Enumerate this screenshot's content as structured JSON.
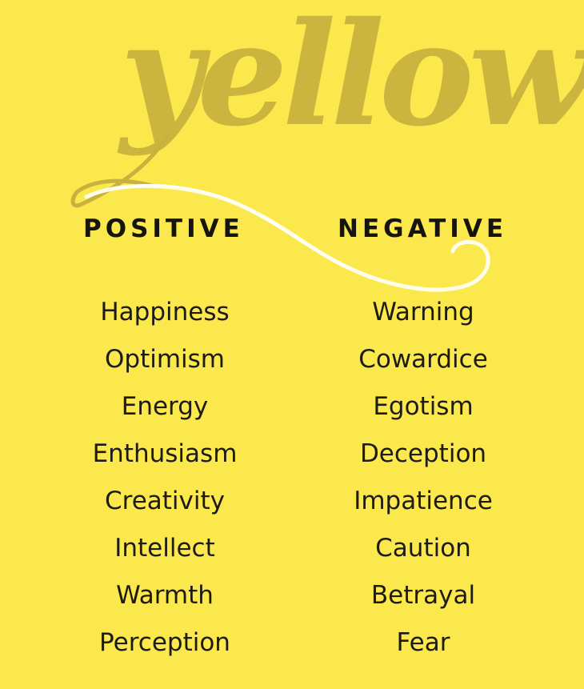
{
  "background_color": "#fbe84d",
  "script_color": "#c9b13e",
  "swirl_color": "#fffef2",
  "title": "yellow",
  "columns": {
    "positive": {
      "header": "POSITIVE",
      "items": [
        "Happiness",
        "Optimism",
        "Energy",
        "Enthusiasm",
        "Creativity",
        "Intellect",
        "Warmth",
        "Perception"
      ]
    },
    "negative": {
      "header": "NEGATIVE",
      "items": [
        "Warning",
        "Cowardice",
        "Egotism",
        "Deception",
        "Impatience",
        "Caution",
        "Betrayal",
        "Fear"
      ]
    }
  }
}
